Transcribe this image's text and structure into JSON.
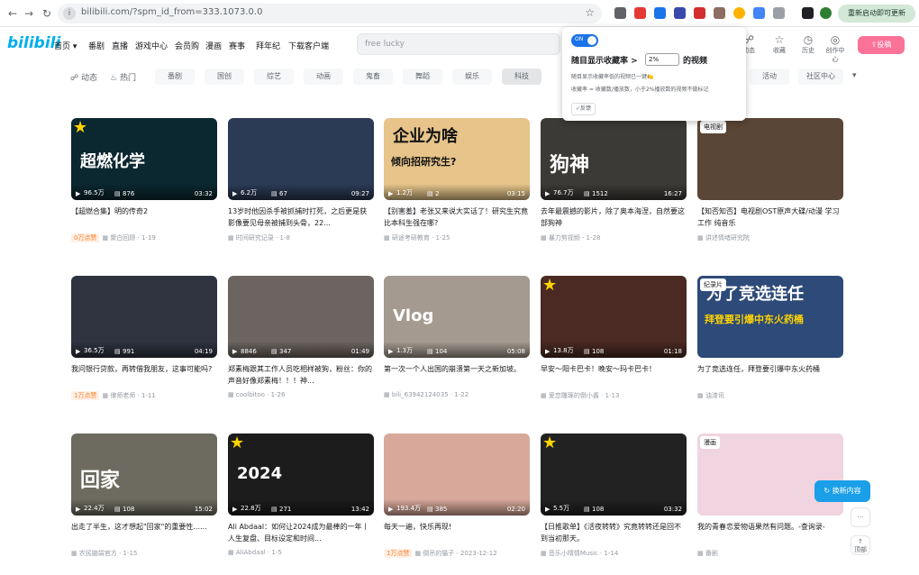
{
  "browser": {
    "url": "bilibili.com/?spm_id_from=333.1073.0.0",
    "update_label": "重新启动即可更新"
  },
  "header": {
    "logo": "bilibili",
    "nav": [
      "首页 ▾",
      "番剧",
      "直播",
      "游戏中心",
      "会员购",
      "漫画",
      "赛事",
      "拜年纪",
      "下载客户端"
    ],
    "search_placeholder": "free lucky",
    "right_icons": [
      {
        "icon": "dynamic-icon",
        "label": "动态"
      },
      {
        "icon": "star-icon",
        "label": "收藏"
      },
      {
        "icon": "history-icon",
        "label": "历史"
      },
      {
        "icon": "lightbulb-icon",
        "label": "创作中心"
      }
    ],
    "upload_label": "投稿"
  },
  "channels": {
    "main": [
      "动态",
      "热门"
    ],
    "chips": [
      "番剧",
      "国创",
      "综艺",
      "动画",
      "鬼畜",
      "舞蹈",
      "娱乐",
      "科技",
      "活动",
      "社区中心"
    ],
    "more": "▾"
  },
  "popup": {
    "toggle_label": "ON",
    "line1_prefix": "随目显示收藏率 >",
    "select_value": "2%",
    "line1_suffix": "的视频",
    "line2": "随目显示收藏率低的视频已一键🍋",
    "line3": "收藏率 = 收藏数/播放数，小于2%播放数的视频不做标记",
    "feedback": "✓反馈"
  },
  "videos": [
    {
      "title": "【超燃合集】明的传奇2",
      "views": "96.5万",
      "danmaku": "876",
      "duration": "03:32",
      "author": "聚白回顾 · 1-19",
      "hot": "0万点赞",
      "star": true,
      "overlay": "超燃化学",
      "bg": "#0b2730"
    },
    {
      "title": "13岁时他因杀手被抓捕时打死，之后更是获影像要见母亲被捕到头骨，22...",
      "views": "6.2万",
      "danmaku": "67",
      "duration": "09:27",
      "author": "时间研究记录 · 1-8",
      "overlay": "",
      "bg": "#2b3a55"
    },
    {
      "title": "【别害羞】老张又来说大实话了！研究生究竟比本科生强在哪?",
      "views": "1.2万",
      "danmaku": "2",
      "duration": "03:15",
      "author": "研途考研教育 · 1-25",
      "overlay": "企业为啥",
      "overlay2": "倾向招研究生?",
      "bg": "#e6c48a"
    },
    {
      "title": "去年最震撼的影片，除了奥本海涅，自然要这部狗神",
      "views": "76.7万",
      "danmaku": "1512",
      "duration": "16:27",
      "author": "暴力剪视频 · 1-28",
      "overlay": "狗神",
      "bg": "#3c3a36"
    },
    {
      "title": "【知否知否】电视剧OST原声大碟/动漫 学习 工作 纯音乐",
      "views": "",
      "danmaku": "",
      "duration": "",
      "author": "讲述情绪研究院",
      "tag": "电视剧",
      "bg": "#5a4636"
    },
    {
      "title": "我问银行贷款，再转借我朋友，这事可能吗?",
      "views": "36.5万",
      "danmaku": "991",
      "duration": "04:19",
      "author": "律师老师 · 1-11",
      "hot": "1万点赞",
      "bg": "#2f3340"
    },
    {
      "title": "郑素梅跟其工作人员吃相样被狗，粉丝：你的声音好像郑素梅！！！神...",
      "views": "8846",
      "danmaku": "347",
      "duration": "01:49",
      "author": "coolbitoo · 1-26",
      "bg": "#6b6460"
    },
    {
      "title": "第一次一个人出国的崩溃第一天之新加坡。",
      "views": "1.3万",
      "danmaku": "104",
      "duration": "05:08",
      "author": "bili_63942124035 · 1-22",
      "overlay": "Vlog",
      "bg": "#a49a8f"
    },
    {
      "title": "早安～阳卡巴卡！晚安～玛卡巴卡！",
      "views": "13.8万",
      "danmaku": "108",
      "duration": "01:18",
      "author": "爱恋雕琢的倒小酱 · 1-13",
      "star": true,
      "bg": "#4a2a22"
    },
    {
      "title": "为了竞选连任，拜登要引爆中东火药桶",
      "views": "",
      "danmaku": "",
      "duration": "",
      "author": "油漆讯",
      "tag": "纪录片",
      "overlay": "为了竞选连任",
      "overlay2": "拜登要引爆中东火药桶",
      "bg": "#2d4a78"
    },
    {
      "title": "出走了半生，这才想起\"回家\"的重要性......",
      "views": "22.4万",
      "danmaku": "108",
      "duration": "15:02",
      "author": "农民脑袋官方 · 1-15",
      "overlay": "回家",
      "bg": "#6d6b5f"
    },
    {
      "title": "Ali Abdaal：如何让2024成为最棒的一年丨人生复盘、目标设定和时间...",
      "views": "22.8万",
      "danmaku": "271",
      "duration": "13:42",
      "author": "AliAbdaal · 1-5",
      "star": true,
      "overlay": "2024",
      "bg": "#1c1c1c"
    },
    {
      "title": "每天一遍，快乐再现!",
      "views": "193.4万",
      "danmaku": "385",
      "duration": "02:20",
      "author": "倒吊的猫子 · 2023-12-12",
      "hot": "1万点赞",
      "bg": "#d8a89a"
    },
    {
      "title": "【日推歌单】《活夜转转》究竟转转还是回不到当初那天。",
      "views": "5.5万",
      "danmaku": "108",
      "duration": "03:32",
      "author": "音乐小晴情Music · 1-14",
      "star": true,
      "bg": "#222"
    },
    {
      "title": "我的青春恋爱物语果然有问题。-查询录-",
      "views": "",
      "danmaku": "",
      "duration": "",
      "author": "番剧",
      "tag": "漫画",
      "bg": "#f0d4e0"
    }
  ],
  "floating": {
    "refresh_label": "换新内容",
    "more_label": "···",
    "top_label": "顶部"
  }
}
